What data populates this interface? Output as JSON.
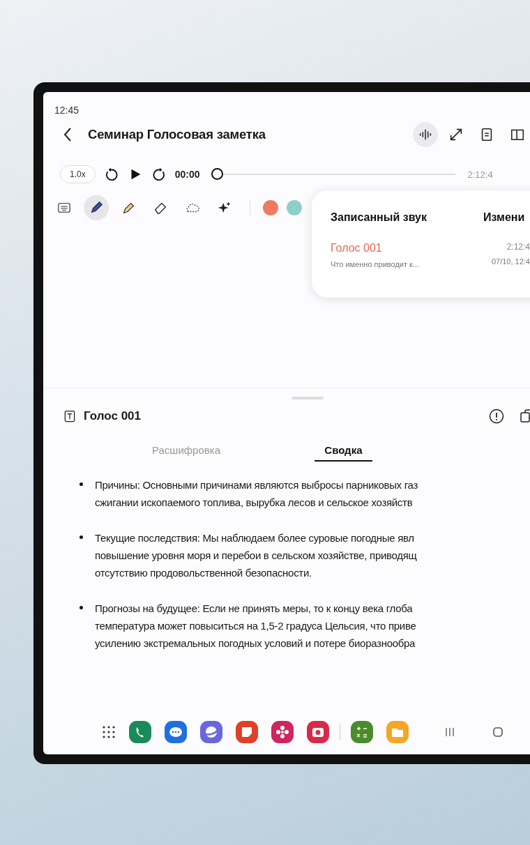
{
  "status_bar": {
    "time": "12:45"
  },
  "header": {
    "title": "Семинар Голосовая заметка",
    "actions": [
      {
        "kind": "waveform",
        "selected": true
      },
      {
        "kind": "expand",
        "selected": false
      },
      {
        "kind": "document",
        "selected": false
      },
      {
        "kind": "book",
        "selected": false
      }
    ]
  },
  "player": {
    "speed": "1.0x",
    "elapsed": "00:00",
    "level": 0,
    "total": "2:12:4"
  },
  "tools": [
    {
      "kind": "keyboard",
      "selected": false
    },
    {
      "kind": "pen",
      "selected": true
    },
    {
      "kind": "highlighter",
      "selected": false
    },
    {
      "kind": "eraser",
      "selected": false
    },
    {
      "kind": "lasso",
      "selected": false
    },
    {
      "kind": "sparkle",
      "selected": false
    }
  ],
  "pen_colors": [
    {
      "color": "#ef7a5f"
    },
    {
      "color": "#8ecfcb"
    }
  ],
  "recordings_popover": {
    "columns": [
      "Записанный звук",
      "Измени"
    ],
    "rows": [
      {
        "name": "Голос 001",
        "preview": "Что именно приводит к...",
        "duration": "2:12:4",
        "modified": "07/10, 12:4"
      }
    ]
  },
  "note": {
    "title": "Голос 001",
    "tabs": [
      {
        "label": "Расшифровка",
        "selected": false
      },
      {
        "label": "Сводка",
        "selected": true
      }
    ],
    "bullets": [
      {
        "lines": [
          "Причины: Основными причинами являются выбросы парниковых газ",
          "сжигании ископаемого топлива, вырубка лесов и сельское хозяйств"
        ]
      },
      {
        "lines": [
          "Текущие последствия: Мы наблюдаем более суровые погодные явл",
          "повышение уровня моря и перебои в сельском хозяйстве, приводящ",
          "отсутствию продовольственной безопасности."
        ]
      },
      {
        "lines": [
          "Прогнозы на будущее: Если не принять меры, то к концу века глоба",
          "температура может повыситься на 1,5-2 градуса Цельсия, что приве",
          "усилению экстремальных погодных условий и потере биоразнообра"
        ]
      }
    ]
  },
  "dock": [
    {
      "kind": "phone",
      "color": "#1a8a5a"
    },
    {
      "kind": "chat",
      "color": "#1f6fe0"
    },
    {
      "kind": "planet",
      "color": "#6a66e0"
    },
    {
      "kind": "note",
      "color": "#e0402a"
    },
    {
      "kind": "flower",
      "color": "#d0245e"
    },
    {
      "kind": "camera",
      "color": "#d82a48"
    },
    {
      "kind": "calculator",
      "color": "#4a8c2a"
    },
    {
      "kind": "folder",
      "color": "#f5a623"
    }
  ]
}
